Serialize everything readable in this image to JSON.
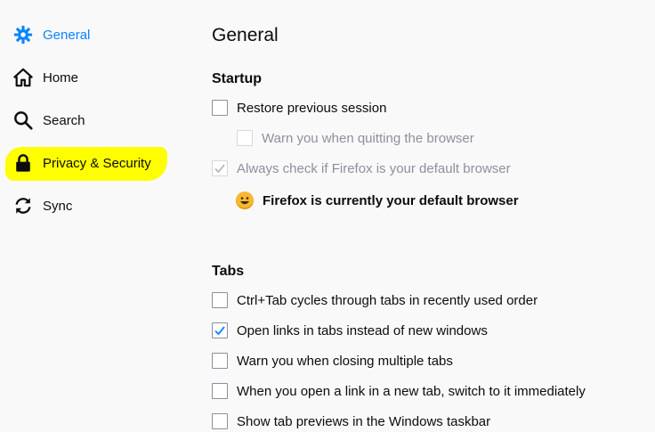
{
  "sidebar": {
    "items": [
      {
        "label": "General",
        "icon": "gear-icon"
      },
      {
        "label": "Home",
        "icon": "home-icon"
      },
      {
        "label": "Search",
        "icon": "search-icon"
      },
      {
        "label": "Privacy & Security",
        "icon": "lock-icon"
      },
      {
        "label": "Sync",
        "icon": "sync-icon"
      }
    ],
    "selected": "General",
    "highlight_color": "#ffff00"
  },
  "main": {
    "title": "General",
    "startup": {
      "heading": "Startup",
      "restore_session": {
        "label": "Restore previous session",
        "checked": false
      },
      "warn_quit": {
        "label": "Warn you when quitting the browser",
        "checked": false,
        "disabled": true
      },
      "default_check": {
        "label": "Always check if Firefox is your default browser",
        "checked": true,
        "disabled": true
      },
      "default_status": "Firefox is currently your default browser"
    },
    "tabs": {
      "heading": "Tabs",
      "options": [
        {
          "label": "Ctrl+Tab cycles through tabs in recently used order",
          "checked": false
        },
        {
          "label": "Open links in tabs instead of new windows",
          "checked": true
        },
        {
          "label": "Warn you when closing multiple tabs",
          "checked": false
        },
        {
          "label": "When you open a link in a new tab, switch to it immediately",
          "checked": false
        },
        {
          "label": "Show tab previews in the Windows taskbar",
          "checked": false
        }
      ]
    }
  },
  "colors": {
    "accent": "#0a84ff",
    "background": "#f9f9fa",
    "check_disabled": "#b1b1b3"
  }
}
